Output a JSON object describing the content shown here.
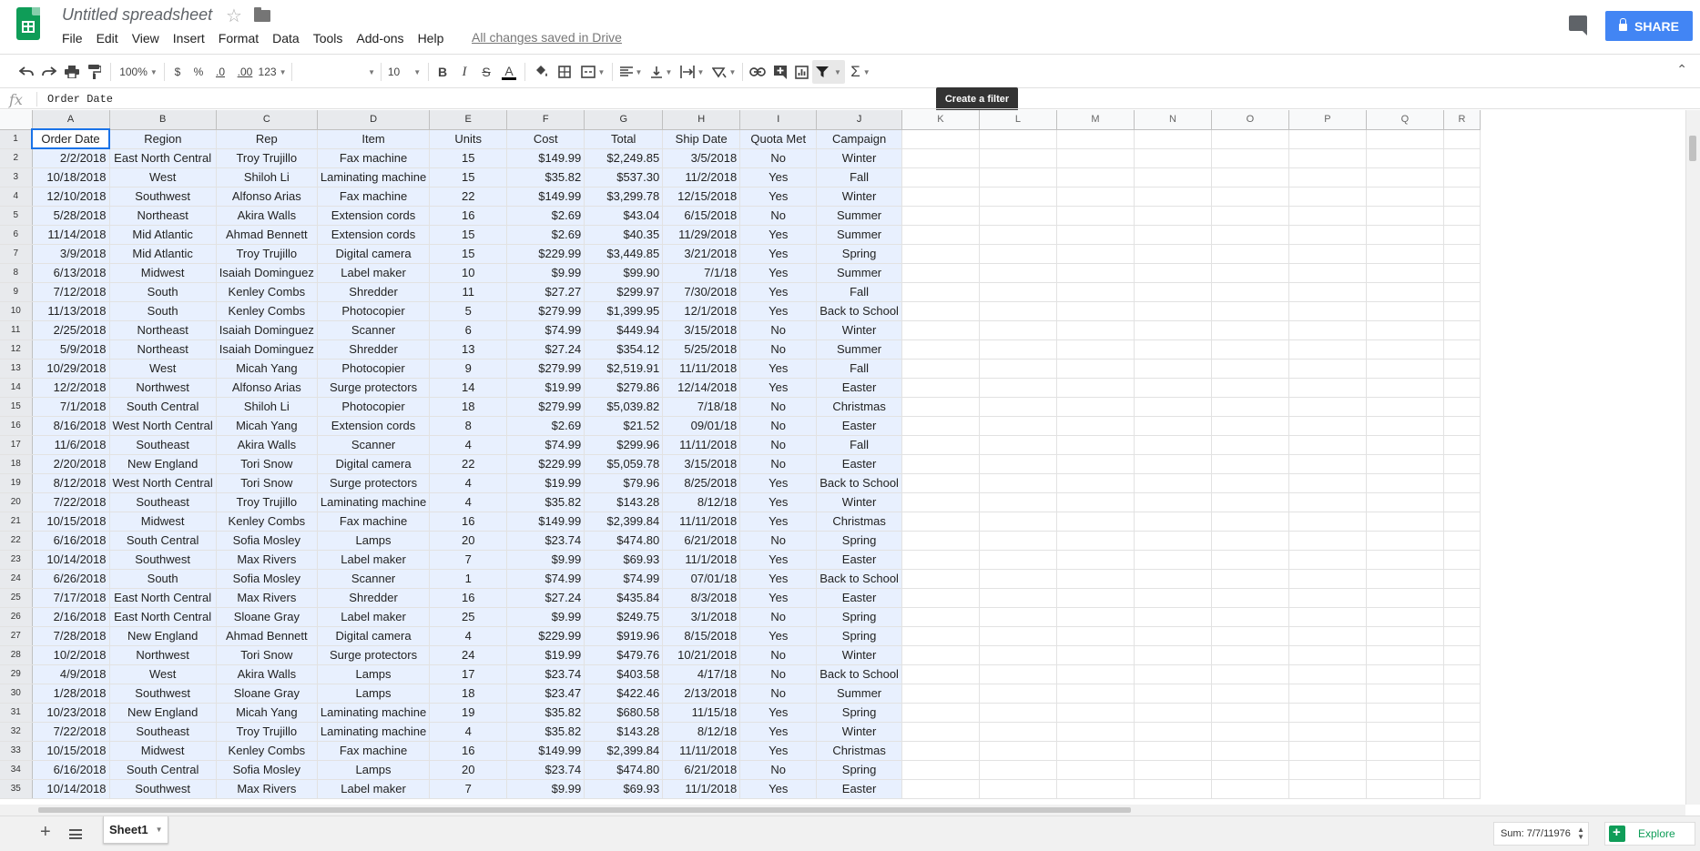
{
  "title": "Untitled spreadsheet",
  "menu": [
    "File",
    "Edit",
    "View",
    "Insert",
    "Format",
    "Data",
    "Tools",
    "Add-ons",
    "Help"
  ],
  "save_status": "All changes saved in Drive",
  "share_label": "SHARE",
  "toolbar": {
    "zoom": "100%",
    "currency": "$",
    "percent": "%",
    "decrease_decimals": ".0",
    "increase_decimals": ".00",
    "more_formats": "123",
    "font_size": "10",
    "bold": "B",
    "italic": "I",
    "strikethrough": "S",
    "text_color": "A",
    "sigma": "Σ",
    "tooltip": "Create a filter"
  },
  "formula_bar": {
    "fx": "fx",
    "value": "Order Date"
  },
  "columns": [
    "A",
    "B",
    "C",
    "D",
    "E",
    "F",
    "G",
    "H",
    "I",
    "J",
    "K",
    "L",
    "M",
    "N",
    "O",
    "P",
    "Q",
    "R"
  ],
  "table": {
    "headers": [
      "Order Date",
      "Region",
      "Rep",
      "Item",
      "Units",
      "Cost",
      "Total",
      "Ship Date",
      "Quota Met",
      "Campaign"
    ],
    "rows": [
      [
        "2/2/2018",
        "East North Central",
        "Troy Trujillo",
        "Fax machine",
        "15",
        "$149.99",
        "$2,249.85",
        "3/5/2018",
        "No",
        "Winter"
      ],
      [
        "10/18/2018",
        "West",
        "Shiloh Li",
        "Laminating machine",
        "15",
        "$35.82",
        "$537.30",
        "11/2/2018",
        "Yes",
        "Fall"
      ],
      [
        "12/10/2018",
        "Southwest",
        "Alfonso Arias",
        "Fax machine",
        "22",
        "$149.99",
        "$3,299.78",
        "12/15/2018",
        "Yes",
        "Winter"
      ],
      [
        "5/28/2018",
        "Northeast",
        "Akira Walls",
        "Extension cords",
        "16",
        "$2.69",
        "$43.04",
        "6/15/2018",
        "No",
        "Summer"
      ],
      [
        "11/14/2018",
        "Mid Atlantic",
        "Ahmad Bennett",
        "Extension cords",
        "15",
        "$2.69",
        "$40.35",
        "11/29/2018",
        "Yes",
        "Summer"
      ],
      [
        "3/9/2018",
        "Mid Atlantic",
        "Troy Trujillo",
        "Digital camera",
        "15",
        "$229.99",
        "$3,449.85",
        "3/21/2018",
        "Yes",
        "Spring"
      ],
      [
        "6/13/2018",
        "Midwest",
        "Isaiah Dominguez",
        "Label maker",
        "10",
        "$9.99",
        "$99.90",
        "7/1/18",
        "Yes",
        "Summer"
      ],
      [
        "7/12/2018",
        "South",
        "Kenley Combs",
        "Shredder",
        "11",
        "$27.27",
        "$299.97",
        "7/30/2018",
        "Yes",
        "Fall"
      ],
      [
        "11/13/2018",
        "South",
        "Kenley Combs",
        "Photocopier",
        "5",
        "$279.99",
        "$1,399.95",
        "12/1/2018",
        "Yes",
        "Back to School"
      ],
      [
        "2/25/2018",
        "Northeast",
        "Isaiah Dominguez",
        "Scanner",
        "6",
        "$74.99",
        "$449.94",
        "3/15/2018",
        "No",
        "Winter"
      ],
      [
        "5/9/2018",
        "Northeast",
        "Isaiah Dominguez",
        "Shredder",
        "13",
        "$27.24",
        "$354.12",
        "5/25/2018",
        "No",
        "Summer"
      ],
      [
        "10/29/2018",
        "West",
        "Micah Yang",
        "Photocopier",
        "9",
        "$279.99",
        "$2,519.91",
        "11/11/2018",
        "Yes",
        "Fall"
      ],
      [
        "12/2/2018",
        "Northwest",
        "Alfonso Arias",
        "Surge protectors",
        "14",
        "$19.99",
        "$279.86",
        "12/14/2018",
        "Yes",
        "Easter"
      ],
      [
        "7/1/2018",
        "South Central",
        "Shiloh Li",
        "Photocopier",
        "18",
        "$279.99",
        "$5,039.82",
        "7/18/18",
        "No",
        "Christmas"
      ],
      [
        "8/16/2018",
        "West North Central",
        "Micah Yang",
        "Extension cords",
        "8",
        "$2.69",
        "$21.52",
        "09/01/18",
        "No",
        "Easter"
      ],
      [
        "11/6/2018",
        "Southeast",
        "Akira Walls",
        "Scanner",
        "4",
        "$74.99",
        "$299.96",
        "11/11/2018",
        "No",
        "Fall"
      ],
      [
        "2/20/2018",
        "New England",
        "Tori Snow",
        "Digital camera",
        "22",
        "$229.99",
        "$5,059.78",
        "3/15/2018",
        "No",
        "Easter"
      ],
      [
        "8/12/2018",
        "West North Central",
        "Tori Snow",
        "Surge protectors",
        "4",
        "$19.99",
        "$79.96",
        "8/25/2018",
        "Yes",
        "Back to School"
      ],
      [
        "7/22/2018",
        "Southeast",
        "Troy Trujillo",
        "Laminating machine",
        "4",
        "$35.82",
        "$143.28",
        "8/12/18",
        "Yes",
        "Winter"
      ],
      [
        "10/15/2018",
        "Midwest",
        "Kenley Combs",
        "Fax machine",
        "16",
        "$149.99",
        "$2,399.84",
        "11/11/2018",
        "Yes",
        "Christmas"
      ],
      [
        "6/16/2018",
        "South Central",
        "Sofia Mosley",
        "Lamps",
        "20",
        "$23.74",
        "$474.80",
        "6/21/2018",
        "No",
        "Spring"
      ],
      [
        "10/14/2018",
        "Southwest",
        "Max Rivers",
        "Label maker",
        "7",
        "$9.99",
        "$69.93",
        "11/1/2018",
        "Yes",
        "Easter"
      ],
      [
        "6/26/2018",
        "South",
        "Sofia Mosley",
        "Scanner",
        "1",
        "$74.99",
        "$74.99",
        "07/01/18",
        "Yes",
        "Back to School"
      ],
      [
        "7/17/2018",
        "East North Central",
        "Max Rivers",
        "Shredder",
        "16",
        "$27.24",
        "$435.84",
        "8/3/2018",
        "Yes",
        "Easter"
      ],
      [
        "2/16/2018",
        "East North Central",
        "Sloane Gray",
        "Label maker",
        "25",
        "$9.99",
        "$249.75",
        "3/1/2018",
        "No",
        "Spring"
      ],
      [
        "7/28/2018",
        "New England",
        "Ahmad Bennett",
        "Digital camera",
        "4",
        "$229.99",
        "$919.96",
        "8/15/2018",
        "Yes",
        "Spring"
      ],
      [
        "10/2/2018",
        "Northwest",
        "Tori Snow",
        "Surge protectors",
        "24",
        "$19.99",
        "$479.76",
        "10/21/2018",
        "No",
        "Winter"
      ],
      [
        "4/9/2018",
        "West",
        "Akira Walls",
        "Lamps",
        "17",
        "$23.74",
        "$403.58",
        "4/17/18",
        "No",
        "Back to School"
      ],
      [
        "1/28/2018",
        "Southwest",
        "Sloane Gray",
        "Lamps",
        "18",
        "$23.47",
        "$422.46",
        "2/13/2018",
        "No",
        "Summer"
      ],
      [
        "10/23/2018",
        "New England",
        "Micah Yang",
        "Laminating machine",
        "19",
        "$35.82",
        "$680.58",
        "11/15/18",
        "Yes",
        "Spring"
      ],
      [
        "7/22/2018",
        "Southeast",
        "Troy Trujillo",
        "Laminating machine",
        "4",
        "$35.82",
        "$143.28",
        "8/12/18",
        "Yes",
        "Winter"
      ],
      [
        "10/15/2018",
        "Midwest",
        "Kenley Combs",
        "Fax machine",
        "16",
        "$149.99",
        "$2,399.84",
        "11/11/2018",
        "Yes",
        "Christmas"
      ],
      [
        "6/16/2018",
        "South Central",
        "Sofia Mosley",
        "Lamps",
        "20",
        "$23.74",
        "$474.80",
        "6/21/2018",
        "No",
        "Spring"
      ],
      [
        "10/14/2018",
        "Southwest",
        "Max Rivers",
        "Label maker",
        "7",
        "$9.99",
        "$69.93",
        "11/1/2018",
        "Yes",
        "Easter"
      ]
    ]
  },
  "sheet_tab": "Sheet1",
  "sum": "Sum: 7/7/11976",
  "explore_label": "Explore"
}
